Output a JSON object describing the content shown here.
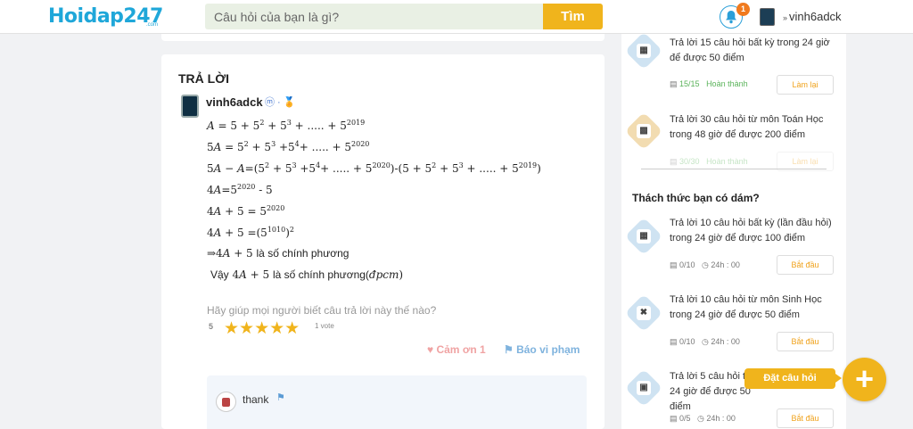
{
  "header": {
    "logo": "Hoidap247",
    "logo_suffix": ".com",
    "search_placeholder": "Câu hỏi của bạn là gì?",
    "search_button": "Tìm",
    "notification_count": "1",
    "username": "vinh6adck"
  },
  "answer": {
    "title": "TRẢ LỜI",
    "author": "vinh6adck",
    "medals": "· ",
    "lines": [
      "A = 5 + 5² + 5³ + ..... + 5²⁰¹⁹"
    ],
    "help_text": "Hãy giúp mọi người biết câu trả lời này thế nào?",
    "rating": "5",
    "stars": "★★★★★",
    "votes": "1 vote",
    "thanks_label": "Cảm ơn 1",
    "report_label": "Báo vi phạm",
    "comment": {
      "text": "thank"
    }
  },
  "sidebar": {
    "tasks_top": [
      {
        "text": "Trả lời 15 câu hỏi  bất kỳ  trong 24 giờ để được 50 điểm",
        "progress": "15/15",
        "status": "Hoàn thành",
        "button": "Làm lại"
      },
      {
        "text": "Trả lời 30 câu hỏi  từ môn Toán Học  trong 48 giờ để được 200 điểm",
        "progress": "30/30",
        "status": "Hoàn thành",
        "button": "Làm lại"
      }
    ],
    "challenge_title": "Thách thức bạn có dám?",
    "challenges": [
      {
        "text": "Trả lời 10 câu hỏi  bất kỳ (lần đầu hỏi)  trong 24 giờ để được 100 điểm",
        "progress": "0/10",
        "time": "24h : 00",
        "button": "Bắt đầu"
      },
      {
        "text": "Trả lời 10 câu hỏi  từ môn Sinh Học  trong 24 giờ để được 50 điểm",
        "progress": "0/10",
        "time": "24h : 00",
        "button": "Bắt đầu"
      },
      {
        "text": "Trả lời 5 câu hỏi  trong 24 giờ để được 50 điểm",
        "progress": "0/5",
        "time": "24h : 00",
        "button": "Bắt đầu"
      }
    ]
  },
  "fab": {
    "label": "Đặt câu hỏi",
    "plus": "+"
  },
  "colors": {
    "brand": "#1fa7d9",
    "accent": "#f0b41c",
    "sidebar_icon": "#cfe3f2",
    "math_icon": "#f2dcb1"
  }
}
